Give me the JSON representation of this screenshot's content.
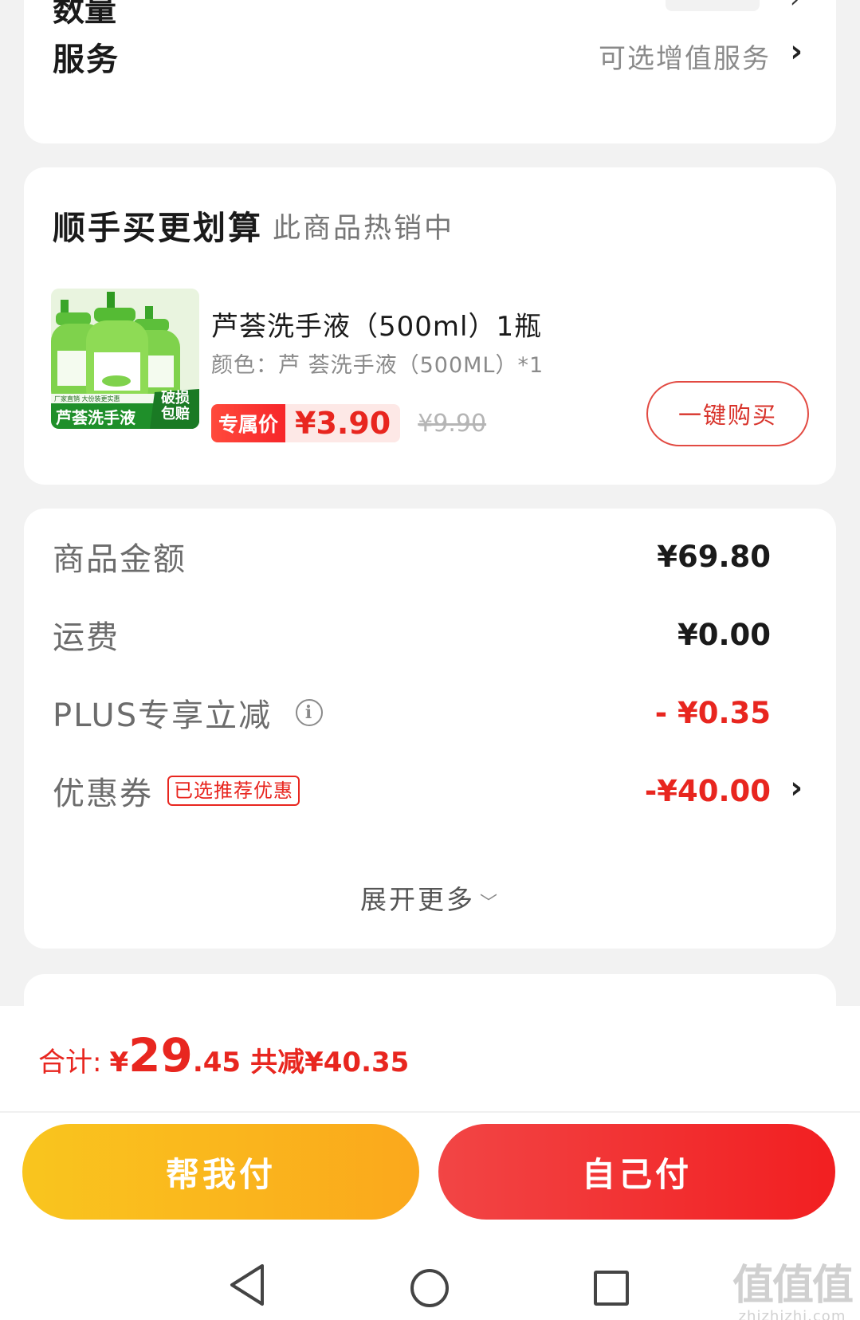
{
  "top_card": {
    "quantity_label": "数量",
    "service_label": "服务",
    "service_value": "可选增值服务",
    "chevron": "›"
  },
  "bundle": {
    "title": "顺手买更划算",
    "subtitle": "此商品热销中",
    "product": {
      "name": "芦荟洗手液（500ml）1瓶",
      "spec": "颜色：芦 荟洗手液（500ML）*1",
      "tag": "专属价",
      "price": "¥3.90",
      "original_price": "¥9.90",
      "image_caption": "芦荟洗手液",
      "image_badge": "破损包赔",
      "image_banner": "厂家直销 大份装更实惠"
    },
    "buy_button": "一键购买"
  },
  "summary": {
    "rows": [
      {
        "label": "商品金额",
        "value": "¥69.80"
      },
      {
        "label": "运费",
        "value": "¥0.00"
      },
      {
        "label": "PLUS专享立减",
        "value": "- ¥0.35"
      },
      {
        "label": "优惠券",
        "badge": "已选推荐优惠",
        "value": "-¥40.00"
      }
    ],
    "expand": "展开更多",
    "expand_icon": "chevron-down"
  },
  "footer": {
    "total_label": "合计:",
    "total_currency": "¥",
    "total_int": "29",
    "total_dec": ".45",
    "saved": "共减¥40.35",
    "pay_friend": "帮我付",
    "pay_self": "自己付",
    "watermark": "值值值",
    "watermark_url": "zhizhizhi.com"
  },
  "colors": {
    "accent_red": "#e8261f",
    "friend_pay_yellow": "#f9c51e",
    "self_pay_red": "#f21f21"
  }
}
